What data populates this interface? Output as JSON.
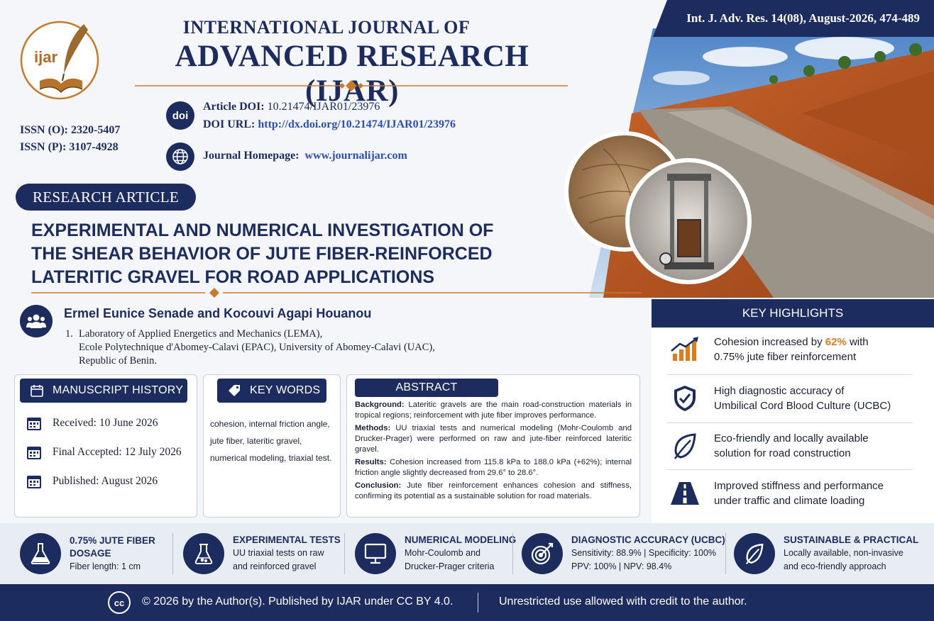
{
  "header": {
    "logo_text": "ijar",
    "journal_line1": "INTERNATIONAL JOURNAL OF",
    "journal_line2": "ADVANCED RESEARCH (IJAR)",
    "issn_online": "ISSN (O): 2320-5407",
    "issn_print": "ISSN (P): 3107-4928",
    "doi_icon_text": "doi",
    "article_doi_label": "Article DOI:",
    "article_doi_value": "10.21474/IJAR01/23976",
    "doi_url_label": "DOI URL:",
    "doi_url_value": "http://dx.doi.org/10.21474/IJAR01/23976",
    "homepage_label": "Journal Homepage:",
    "homepage_value": "www.journalijar.com",
    "citation": "Int. J. Adv. Res. 14(08), August-2026, 474-489"
  },
  "article": {
    "type_label": "RESEARCH ARTICLE",
    "title_lines": [
      "EXPERIMENTAL AND NUMERICAL INVESTIGATION OF",
      "THE SHEAR BEHAVIOR OF JUTE FIBER-REINFORCED",
      "LATERITIC GRAVEL FOR ROAD APPLICATIONS"
    ],
    "authors": "Ermel Eunice Senade and Kocouvi Agapi Houanou",
    "affiliation_number": "1.",
    "affiliation_lines": [
      "Laboratory of Applied Energetics and Mechanics (LEMA),",
      "Ecole Polytechnique d'Abomey-Calavi (EPAC), University of Abomey-Calavi (UAC),",
      "Republic of Benin."
    ]
  },
  "manuscript_history": {
    "heading": "MANUSCRIPT HISTORY",
    "received": "Received: 10 June 2026",
    "accepted": "Final Accepted: 12 July 2026",
    "published": "Published: August 2026"
  },
  "keywords": {
    "heading": "KEY WORDS",
    "lines": [
      "cohesion, internal friction angle,",
      "jute fiber, lateritic gravel,",
      "numerical modeling, triaxial test."
    ]
  },
  "abstract": {
    "heading": "ABSTRACT",
    "background_label": "Background:",
    "background_text": "Lateritic gravels are the main road-construction materials in tropical regions; reinforcement with jute fiber improves performance.",
    "methods_label": "Methods:",
    "methods_text": "UU triaxial tests and numerical modeling (Mohr-Coulomb and Drucker-Prager) were performed on raw and jute-fiber reinforced lateritic gravel.",
    "results_label": "Results:",
    "results_text": "Cohesion increased from 115.8 kPa to 188.0 kPa (+62%); internal friction angle slightly decreased from 29.6° to 28.6°.",
    "conclusion_label": "Conclusion:",
    "conclusion_text": "Jute fiber reinforcement enhances cohesion and stiffness, confirming its potential as a sustainable solution for road materials."
  },
  "highlights": {
    "heading": "KEY HIGHLIGHTS",
    "h1_pre": "Cohesion increased by ",
    "h1_value": "62%",
    "h1_post": " with",
    "h1_line2": "0.75% jute fiber reinforcement",
    "h2_line1": "High diagnostic accuracy of",
    "h2_line2": "Umbilical Cord Blood Culture (UCBC)",
    "h3_line1": "Eco-friendly and locally available",
    "h3_line2": "solution for road construction",
    "h4_line1": "Improved stiffness and performance",
    "h4_line2": "under traffic and climate loading",
    "accent_color": "#e07b1a"
  },
  "features": [
    {
      "title1": "0.75% JUTE FIBER",
      "title2": "DOSAGE",
      "desc1": "Fiber length: 1 cm",
      "desc2": ""
    },
    {
      "title1": "EXPERIMENTAL TESTS",
      "title2": "",
      "desc1": "UU triaxial tests on raw",
      "desc2": "and reinforced gravel"
    },
    {
      "title1": "NUMERICAL MODELING",
      "title2": "",
      "desc1": "Mohr-Coulomb and",
      "desc2": "Drucker-Prager criteria"
    },
    {
      "title1": "DIAGNOSTIC ACCURACY (UCBC)",
      "title2": "",
      "desc1": "Sensitivity: 88.9% | Specificity: 100%",
      "desc2": "PPV: 100%  |  NPV: 98.4%"
    },
    {
      "title1": "SUSTAINABLE & PRACTICAL",
      "title2": "",
      "desc1": "Locally available, non-invasive",
      "desc2": "and eco-friendly approach"
    }
  ],
  "footer": {
    "cc_icon_text": "cc",
    "license": "© 2026 by the Author(s). Published by IJAR under CC BY 4.0.",
    "usage": "Unrestricted use allowed with credit to the author."
  },
  "colors": {
    "navy": "#1d2c5e",
    "accent": "#e07b1a",
    "link": "#2a4fb6"
  }
}
